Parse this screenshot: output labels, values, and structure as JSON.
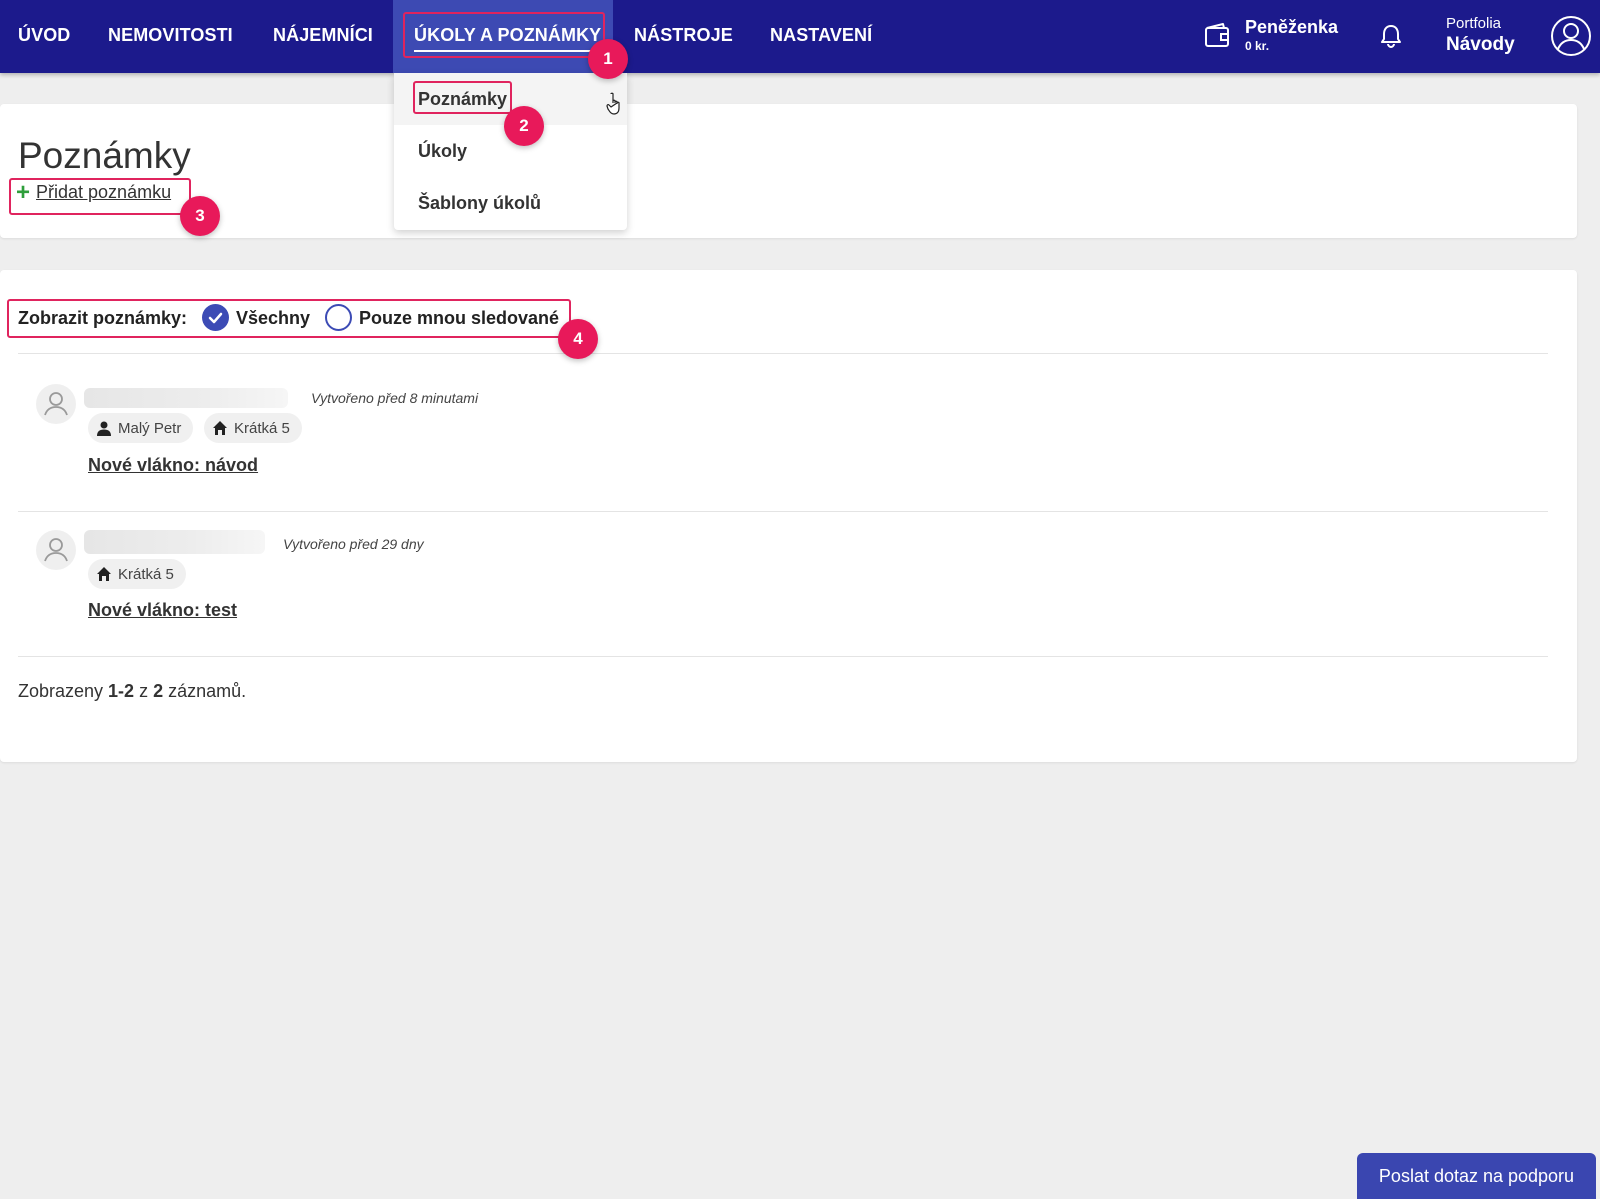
{
  "nav": {
    "items": [
      "ÚVOD",
      "NEMOVITOSTI",
      "NÁJEMNÍCI",
      "ÚKOLY A POZNÁMKY",
      "NÁSTROJE",
      "NASTAVENÍ"
    ],
    "wallet": {
      "title": "Peněženka",
      "amount": "0 kr.",
      "icon": "wallet-icon"
    },
    "bell_icon": "bell-icon",
    "portfolio": {
      "label": "Portfolia",
      "name": "Návody"
    },
    "user_icon": "user-circle-icon"
  },
  "dropdown": {
    "items": [
      "Poznámky",
      "Úkoly",
      "Šablony úkolů"
    ]
  },
  "page": {
    "title": "Poznámky",
    "add_note": "Přidat poznámku"
  },
  "filter": {
    "label": "Zobrazit poznámky:",
    "options": [
      {
        "label": "Všechny",
        "selected": true
      },
      {
        "label": "Pouze mnou sledované",
        "selected": false
      }
    ]
  },
  "notes": [
    {
      "created": "Vytvořeno před 8 minutami",
      "tags": [
        {
          "icon": "person-icon",
          "label": "Malý Petr"
        },
        {
          "icon": "home-icon",
          "label": "Krátká 5"
        }
      ],
      "title": "Nové vlákno: návod"
    },
    {
      "created": "Vytvořeno před 29 dny",
      "tags": [
        {
          "icon": "home-icon",
          "label": "Krátká 5"
        }
      ],
      "title": "Nové vlákno: test"
    }
  ],
  "summary": {
    "prefix": "Zobrazeny ",
    "range": "1-2",
    "middle": " z ",
    "total": "2",
    "suffix": " záznamů."
  },
  "badges": [
    "1",
    "2",
    "3",
    "4"
  ],
  "support_button": "Poslat dotaz na podporu",
  "colors": {
    "nav_bg": "#1c1a8c",
    "nav_active": "#3d4ab3",
    "highlight": "#e0245e",
    "badge": "#e8195a",
    "radio": "#3c4bb5",
    "plus": "#2e9e3b"
  }
}
